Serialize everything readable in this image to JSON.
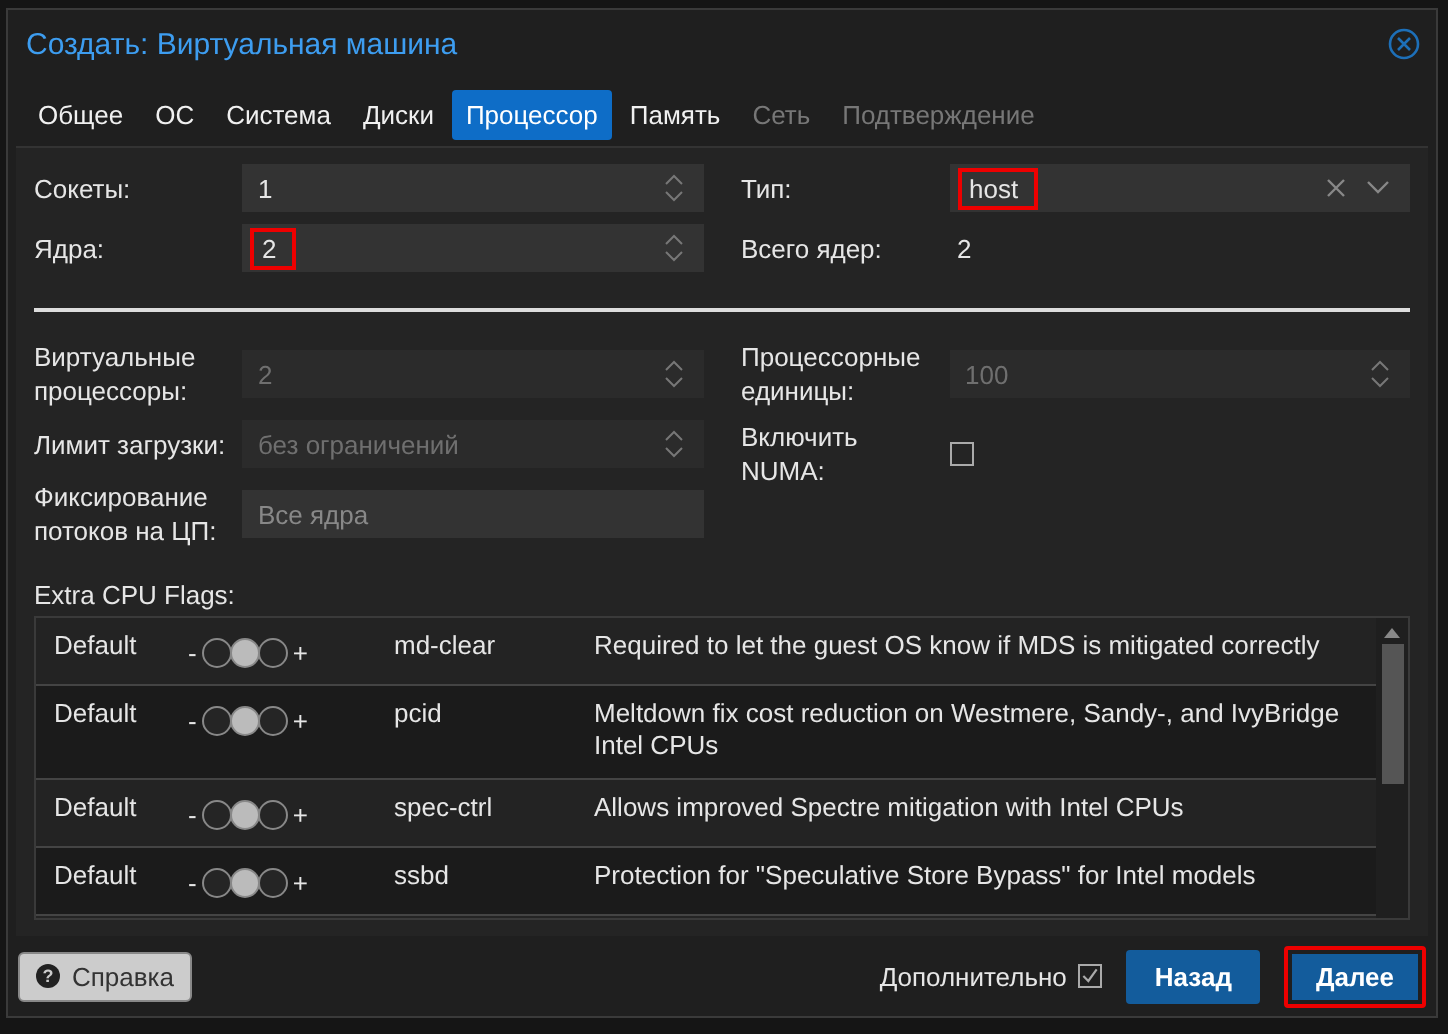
{
  "window": {
    "title": "Создать: Виртуальная машина"
  },
  "tabs": [
    {
      "label": "Общее",
      "selected": false,
      "disabled": false
    },
    {
      "label": "ОС",
      "selected": false,
      "disabled": false
    },
    {
      "label": "Система",
      "selected": false,
      "disabled": false
    },
    {
      "label": "Диски",
      "selected": false,
      "disabled": false
    },
    {
      "label": "Процессор",
      "selected": true,
      "disabled": false
    },
    {
      "label": "Память",
      "selected": false,
      "disabled": false
    },
    {
      "label": "Сеть",
      "selected": false,
      "disabled": true
    },
    {
      "label": "Подтверждение",
      "selected": false,
      "disabled": true
    }
  ],
  "basic_left": [
    {
      "label": "Сокеты:",
      "value": "1",
      "kind": "spinner",
      "disabled": false
    },
    {
      "label": "Ядра:",
      "value": "2",
      "kind": "spinner",
      "disabled": false,
      "highlighted": true
    }
  ],
  "basic_right": [
    {
      "label": "Тип:",
      "value": "host",
      "kind": "combo",
      "disabled": false,
      "highlighted": true
    },
    {
      "label": "Всего ядер:",
      "value": "2",
      "kind": "text"
    }
  ],
  "advanced_left": [
    {
      "label": "Виртуальные процессоры:",
      "value": "2",
      "kind": "spinner",
      "disabled": true
    },
    {
      "label": "Лимит загрузки:",
      "value": "без ограничений",
      "kind": "spinner",
      "disabled": true
    },
    {
      "label": "Фиксирование потоков на ЦП:",
      "placeholder": "Все ядра",
      "kind": "field"
    }
  ],
  "advanced_right": [
    {
      "label": "Процессорные единицы:",
      "value": "100",
      "kind": "spinner",
      "disabled": true
    },
    {
      "label": "Включить NUMA:",
      "kind": "checkbox",
      "checked": false
    }
  ],
  "cpu_flags": {
    "label": "Extra CPU Flags:",
    "rows": [
      {
        "default": "Default",
        "minus": "-",
        "plus": "+",
        "toggle": [
          {
            "selected": false
          },
          {
            "selected": true
          },
          {
            "selected": false
          }
        ],
        "flag": "md-clear",
        "description": "Required to let the guest OS know if MDS is mitigated correctly"
      },
      {
        "default": "Default",
        "minus": "-",
        "plus": "+",
        "toggle": [
          {
            "selected": false
          },
          {
            "selected": true
          },
          {
            "selected": false
          }
        ],
        "flag": "pcid",
        "description": "Meltdown fix cost reduction on Westmere, Sandy-, and IvyBridge Intel CPUs"
      },
      {
        "default": "Default",
        "minus": "-",
        "plus": "+",
        "toggle": [
          {
            "selected": false
          },
          {
            "selected": true
          },
          {
            "selected": false
          }
        ],
        "flag": "spec-ctrl",
        "description": "Allows improved Spectre mitigation with Intel CPUs"
      },
      {
        "default": "Default",
        "minus": "-",
        "plus": "+",
        "toggle": [
          {
            "selected": false
          },
          {
            "selected": true
          },
          {
            "selected": false
          }
        ],
        "flag": "ssbd",
        "description": "Protection for \"Speculative Store Bypass\" for Intel models"
      }
    ]
  },
  "footer": {
    "help": {
      "icon": "?",
      "label": "Справка"
    },
    "advanced": {
      "label": "Дополнительно",
      "checked": true
    },
    "buttons": [
      {
        "label": "Назад"
      },
      {
        "label": "Далее",
        "highlighted": true
      }
    ]
  }
}
